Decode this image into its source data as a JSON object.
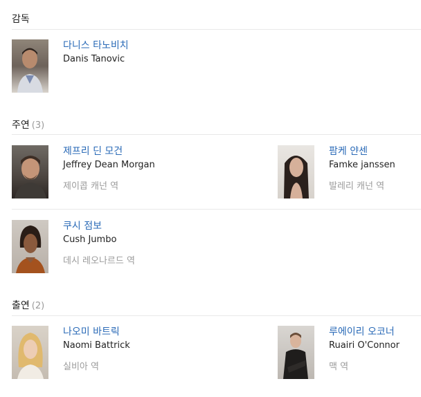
{
  "directors": {
    "title": "감독",
    "people": [
      {
        "name_ko": "다니스 타노비치",
        "name_en": "Danis Tanovic"
      }
    ]
  },
  "leads": {
    "title": "주연",
    "count": "(3)",
    "people": [
      {
        "name_ko": "제프리 딘 모건",
        "name_en": "Jeffrey Dean Morgan",
        "role": "제이콥 캐넌 역"
      },
      {
        "name_ko": "팜케 얀센",
        "name_en": "Famke janssen",
        "role": "발레리 캐넌 역"
      },
      {
        "name_ko": "쿠시 점보",
        "name_en": "Cush Jumbo",
        "role": "데시 레오나르드 역"
      }
    ]
  },
  "cast": {
    "title": "출연",
    "count": "(2)",
    "people": [
      {
        "name_ko": "나오미 바트릭",
        "name_en": "Naomi Battrick",
        "role": "실비아 역"
      },
      {
        "name_ko": "루에이리 오코너",
        "name_en": "Ruairi O'Connor",
        "role": "맥 역"
      }
    ]
  }
}
